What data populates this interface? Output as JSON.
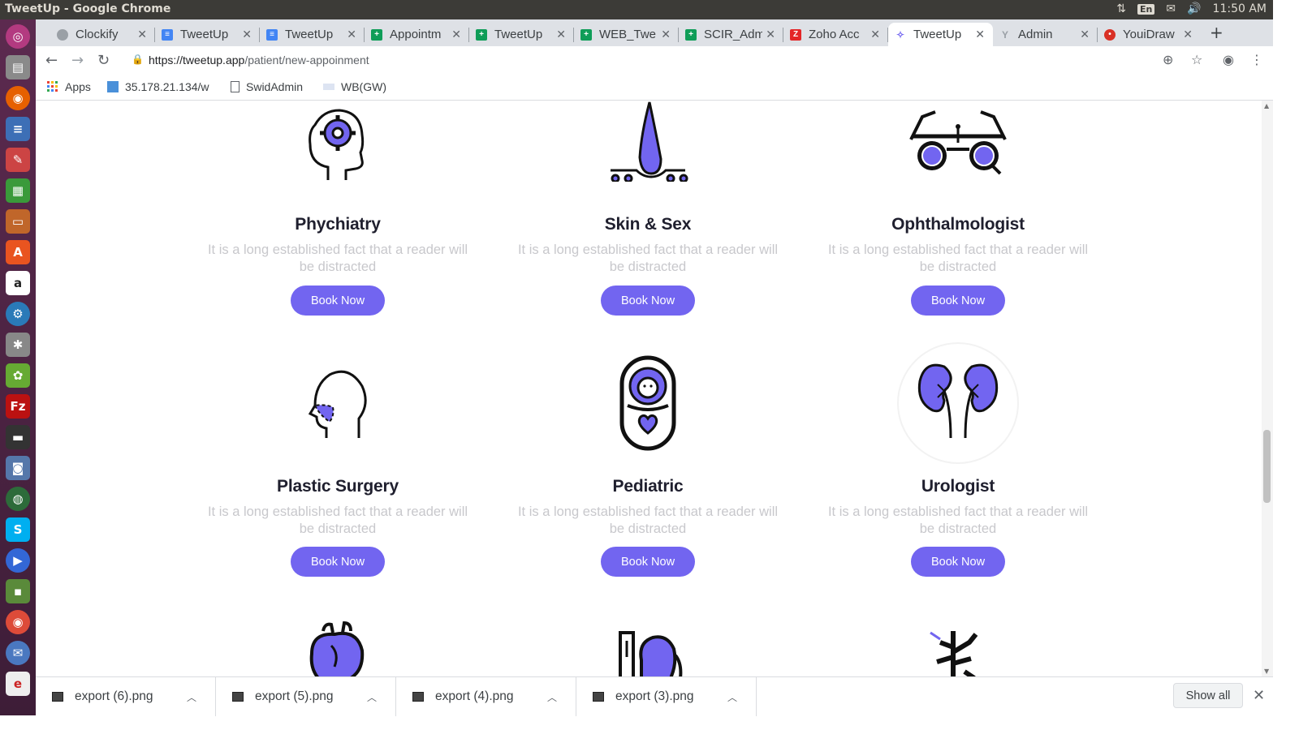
{
  "os": {
    "window_title": "TweetUp - Google Chrome",
    "lang": "En",
    "clock": "11:50 AM"
  },
  "browser": {
    "tabs": [
      {
        "label": "Clockify",
        "color": "#9aa0a6"
      },
      {
        "label": "TweetUp",
        "color": "#4285f4"
      },
      {
        "label": "TweetUp",
        "color": "#4285f4"
      },
      {
        "label": "Appointm",
        "color": "#0f9d58"
      },
      {
        "label": "TweetUp",
        "color": "#0f9d58"
      },
      {
        "label": "WEB_Twe",
        "color": "#0f9d58"
      },
      {
        "label": "SCIR_Adm",
        "color": "#0f9d58"
      },
      {
        "label": "Zoho Acc",
        "color": "#e42527"
      },
      {
        "label": "TweetUp",
        "color": "#7265f0"
      },
      {
        "label": "Admin",
        "color": "#9aa0a6"
      },
      {
        "label": "YouiDraw",
        "color": "#d93025"
      }
    ],
    "url_host": "https://tweetup.app",
    "url_path": "/patient/new-appoinment",
    "bookmarks": [
      {
        "label": "Apps"
      },
      {
        "label": "35.178.21.134/w"
      },
      {
        "label": "SwidAdmin"
      },
      {
        "label": "WB(GW)"
      }
    ]
  },
  "page": {
    "accent": "#7265f0",
    "book_label": "Book Now",
    "description": "It is a long established fact that a reader will be distracted",
    "cards": [
      {
        "title": "Phychiatry",
        "icon": "brain-gear-icon"
      },
      {
        "title": "Skin & Sex",
        "icon": "skin-hair-icon"
      },
      {
        "title": "Ophthalmologist",
        "icon": "eye-test-glasses-icon"
      },
      {
        "title": "Plastic Surgery",
        "icon": "face-profile-icon"
      },
      {
        "title": "Pediatric",
        "icon": "swaddled-baby-icon"
      },
      {
        "title": "Urologist",
        "icon": "kidneys-icon"
      }
    ]
  },
  "downloads": {
    "files": [
      "export (6).png",
      "export (5).png",
      "export (4).png",
      "export (3).png"
    ],
    "show_all": "Show all"
  }
}
